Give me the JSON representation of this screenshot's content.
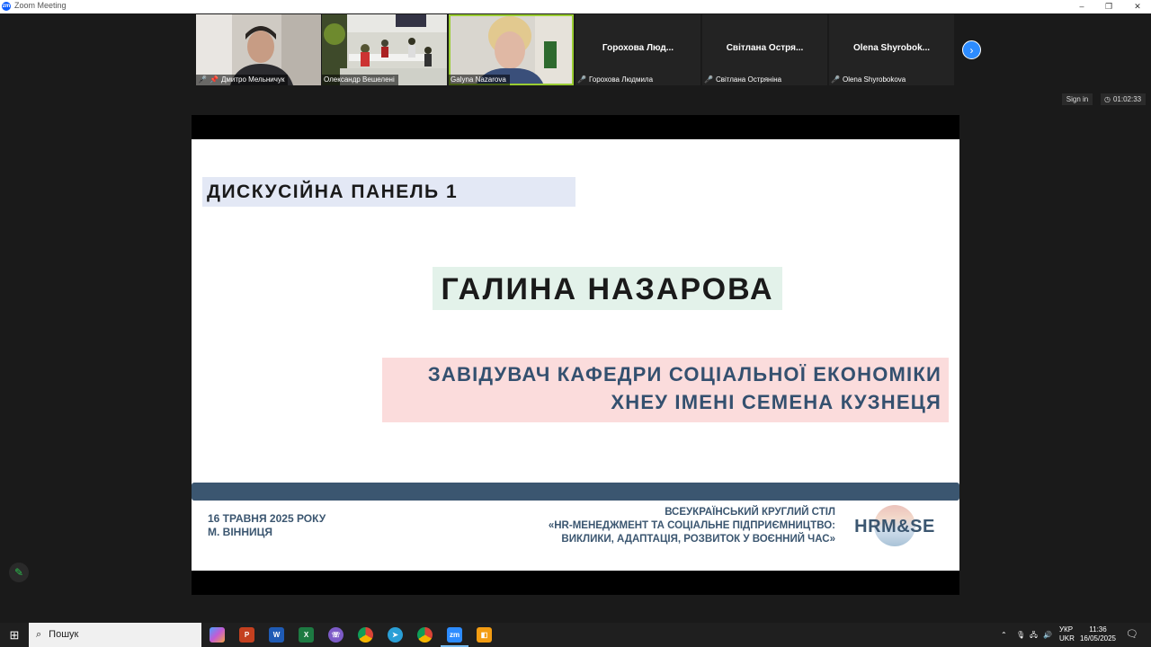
{
  "window": {
    "title": "Zoom Meeting",
    "controls": [
      "–",
      "❐",
      "✕"
    ]
  },
  "participants": [
    {
      "name": "Дмитро Мельничук",
      "muted": true,
      "pinned": true,
      "video": true
    },
    {
      "name": "Олександр Вешелені",
      "muted": false,
      "video": true
    },
    {
      "name": "Galyna Nazarova",
      "muted": false,
      "video": true,
      "active_speaker": true
    },
    {
      "name": "Горохова Людмила",
      "short": "Горохова Люд...",
      "muted": true,
      "video": false
    },
    {
      "name": "Світлана Остряніна",
      "short": "Світлана Остря...",
      "muted": true,
      "video": false
    },
    {
      "name": "Olena Shyrobokova",
      "short": "Olena Shyrobok...",
      "muted": true,
      "video": false
    }
  ],
  "next_page_icon": "chevron-right-icon",
  "sign_in": "Sign in",
  "timer": "01:02:33",
  "slide": {
    "panel_label": "ДИСКУСІЙНА ПАНЕЛЬ 1",
    "speaker_name": "ГАЛИНА НАЗАРОВА",
    "position_line1": "ЗАВІДУВАЧ КАФЕДРИ СОЦІАЛЬНОЇ ЕКОНОМІКИ",
    "position_line2": "ХНЕУ ІМЕНІ СЕМЕНА КУЗНЕЦЯ",
    "date_line1": "16 ТРАВНЯ 2025 РОКУ",
    "date_line2": "М. ВІННИЦЯ",
    "event_line1": "ВСЕУКРАЇНСЬКИЙ КРУГЛИЙ СТІЛ",
    "event_line2": "«HR-МЕНЕДЖМЕНТ ТА СОЦІАЛЬНЕ ПІДПРИЄМНИЦТВО:",
    "event_line3": "ВИКЛИКИ, АДАПТАЦІЯ, РОЗВИТОК У ВОЄННИЙ ЧАС»",
    "logo_text": "HRM&SE",
    "colors": {
      "accent": "#3b5670",
      "panel_bg": "#e3e8f5",
      "name_bg": "#e3f2ea",
      "position_bg": "#fbdcdc"
    }
  },
  "taskbar": {
    "search_placeholder": "Пошук",
    "apps": [
      "copilot-icon",
      "powerpoint-icon",
      "word-icon",
      "excel-icon",
      "viber-icon",
      "chrome-icon",
      "telegram-icon",
      "chrome-profile-icon",
      "zoom-icon",
      "sticky-app-icon"
    ],
    "lang_line1": "УКР",
    "lang_line2": "UKR",
    "time": "11:36",
    "date": "16/05/2025"
  }
}
